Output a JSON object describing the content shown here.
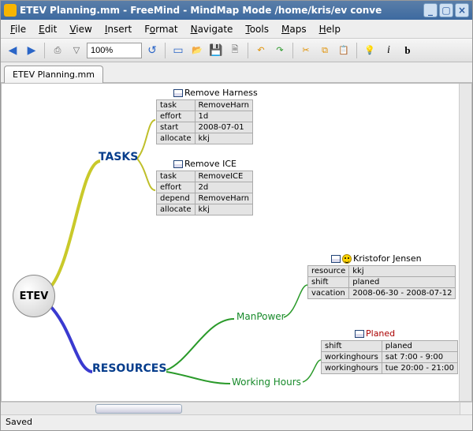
{
  "window": {
    "title": "ETEV Planning.mm - FreeMind - MindMap Mode /home/kris/ev conve"
  },
  "menu": {
    "file": "File",
    "edit": "Edit",
    "view": "View",
    "insert": "Insert",
    "format": "Format",
    "navigate": "Navigate",
    "tools": "Tools",
    "maps": "Maps",
    "help": "Help"
  },
  "toolbar": {
    "zoom": "100%"
  },
  "tab": {
    "label": "ETEV Planning.mm"
  },
  "status": {
    "text": "Saved"
  },
  "mindmap": {
    "root": "ETEV",
    "tasks_label": "TASKS",
    "resources_label": "RESOURCES",
    "manpower_label": "ManPower",
    "workinghours_label": "Working Hours",
    "remove_harness": {
      "title": "Remove Harness",
      "rows": [
        [
          "task",
          "RemoveHarn"
        ],
        [
          "effort",
          "1d"
        ],
        [
          "start",
          "2008-07-01"
        ],
        [
          "allocate",
          "kkj"
        ]
      ]
    },
    "remove_ice": {
      "title": "Remove ICE",
      "rows": [
        [
          "task",
          "RemoveICE"
        ],
        [
          "effort",
          "2d"
        ],
        [
          "depend",
          "RemoveHarn"
        ],
        [
          "allocate",
          "kkj"
        ]
      ]
    },
    "kristofor": {
      "title": "Kristofor Jensen",
      "rows": [
        [
          "resource",
          "kkj"
        ],
        [
          "shift",
          "planed"
        ],
        [
          "vacation",
          "2008-06-30 - 2008-07-12"
        ]
      ]
    },
    "planed": {
      "title": "Planed",
      "rows": [
        [
          "shift",
          "planed"
        ],
        [
          "workinghours",
          "sat 7:00 - 9:00"
        ],
        [
          "workinghours",
          "tue 20:00 - 21:00"
        ]
      ]
    }
  }
}
